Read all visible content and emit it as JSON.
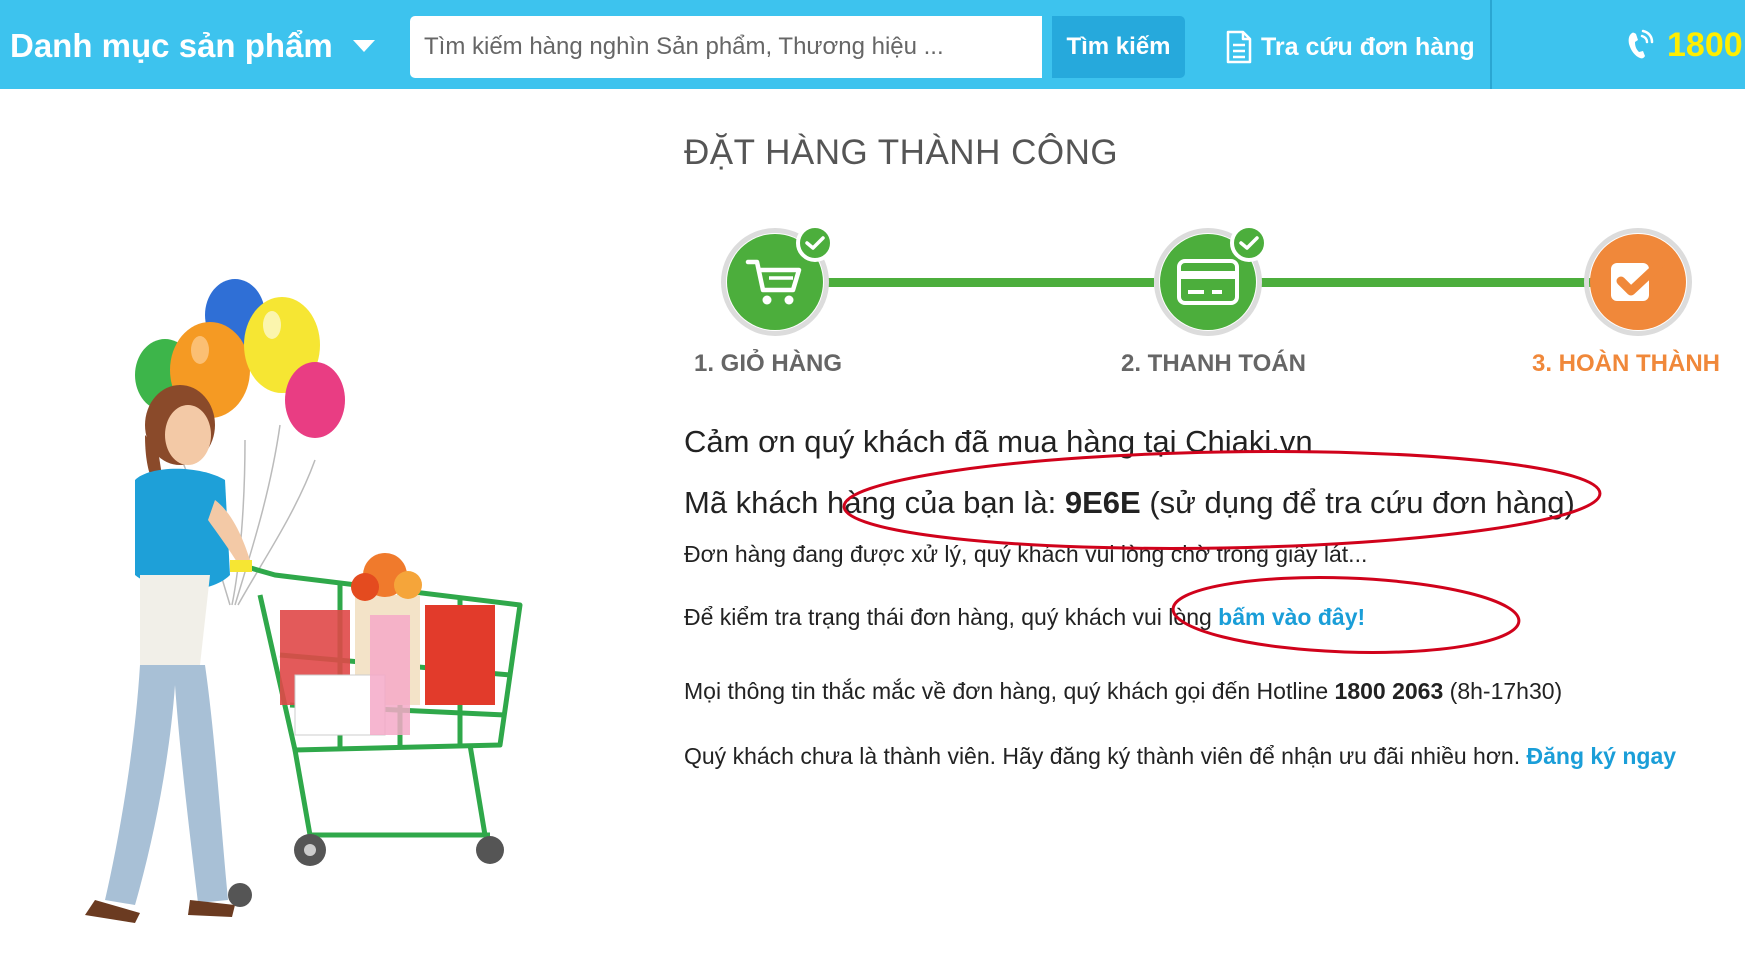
{
  "header": {
    "category_menu": "Danh mục sản phẩm",
    "search_placeholder": "Tìm kiếm hàng nghìn Sản phẩm, Thương hiệu ...",
    "search_button": "Tìm kiếm",
    "order_lookup": "Tra cứu đơn hàng",
    "hotline": "1800"
  },
  "page": {
    "title": "ĐẶT HÀNG THÀNH CÔNG",
    "steps": [
      {
        "label": "1. GIỎ HÀNG",
        "icon": "cart-icon",
        "status": "done"
      },
      {
        "label": "2. THANH TOÁN",
        "icon": "credit-card-icon",
        "status": "done"
      },
      {
        "label": "3. HOÀN THÀNH",
        "icon": "check-icon",
        "status": "active"
      }
    ],
    "thanks": "Cảm ơn quý khách đã mua hàng tại Chiaki.vn",
    "customer_code_prefix": "Mã khách hàng của bạn là:",
    "customer_code": "9E6E",
    "customer_code_suffix": "(sử dụng để tra cứu đơn hàng)",
    "processing": "Đơn hàng đang được xử lý, quý khách vui lòng chờ trong giây lát...",
    "check_status_text": "Để kiểm tra trạng thái đơn hàng, quý khách vui lòng",
    "check_status_link": "bấm vào đây!",
    "hotline_text": "Mọi thông tin thắc mắc về đơn hàng, quý khách gọi đến Hotline",
    "hotline_number": "1800 2063",
    "hotline_hours": "(8h-17h30)",
    "member_text": "Quý khách chưa là thành viên. Hãy đăng ký thành viên để nhận ưu đãi nhiều hơn.",
    "register_link": "Đăng ký ngay"
  },
  "colors": {
    "header_bg": "#3dc3ee",
    "step_green": "#4cae3c",
    "step_orange": "#f0883a",
    "link_blue": "#1a9ed8",
    "hotline_yellow": "#ffee00",
    "annotation_red": "#d0021b"
  }
}
